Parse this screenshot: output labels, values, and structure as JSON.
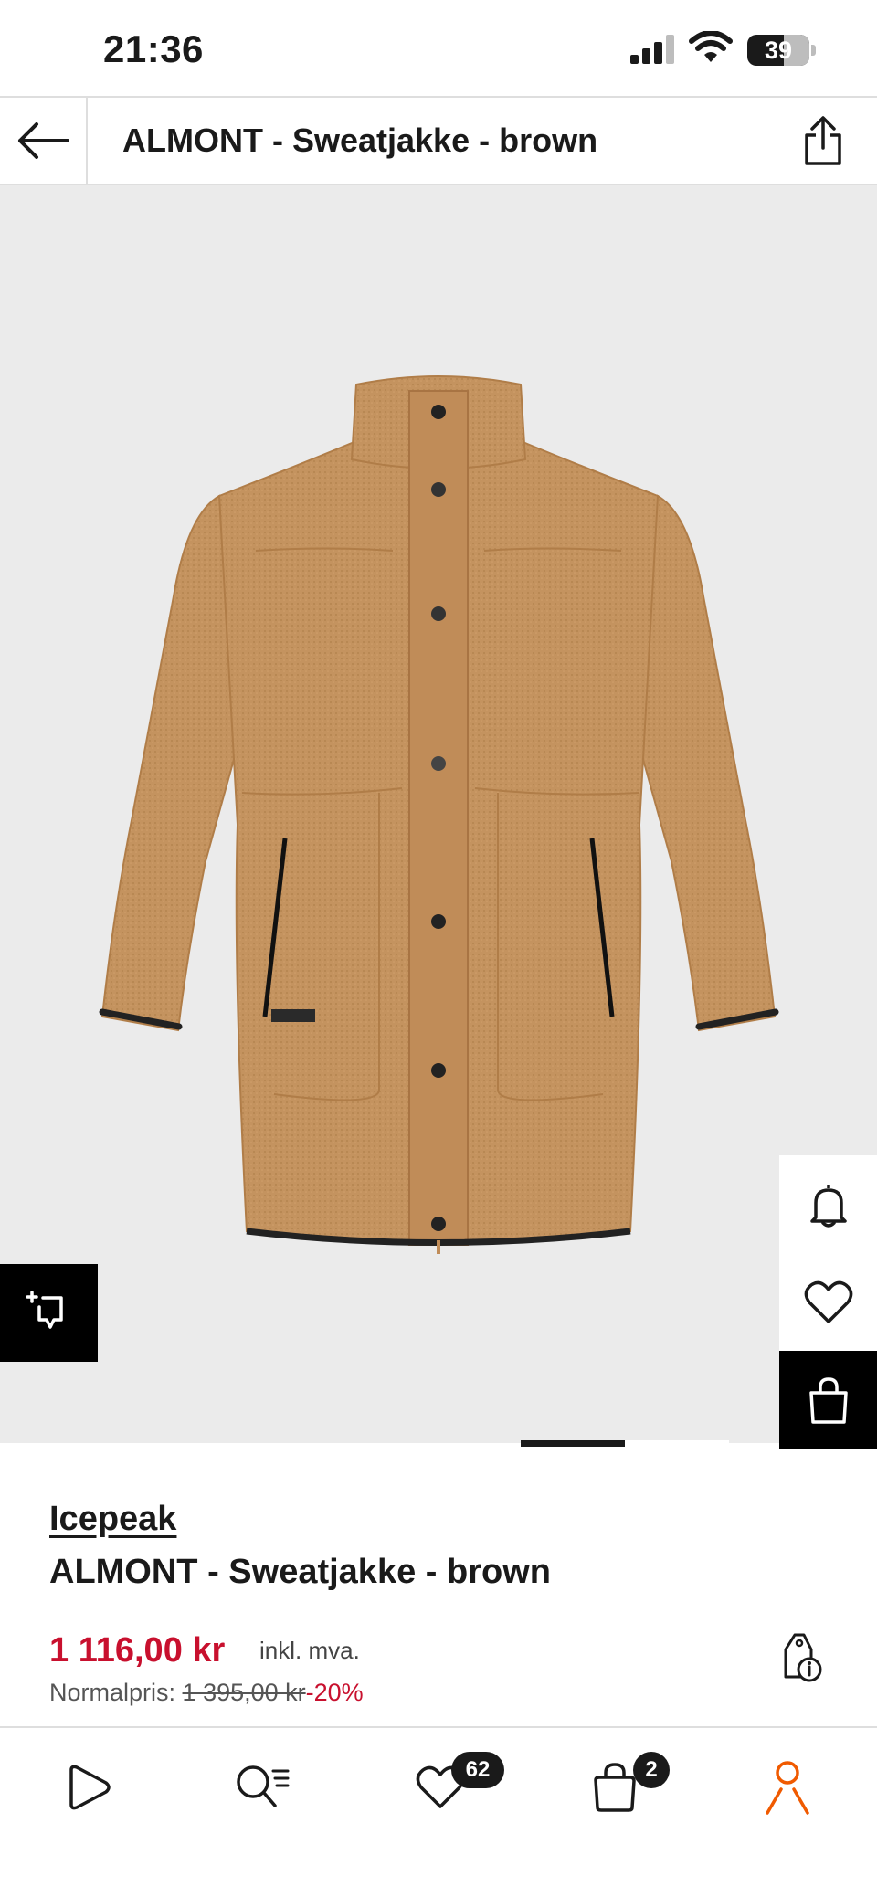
{
  "status_bar": {
    "time": "21:36",
    "battery": "39"
  },
  "header": {
    "title": "ALMONT - Sweatjakke - brown"
  },
  "product": {
    "brand": "Icepeak",
    "name": "ALMONT - Sweatjakke - brown",
    "price": "1 116,00 kr",
    "vat_note": "inkl. mva.",
    "normal_price_label": "Normalpris:",
    "normal_price": "1 395,00 kr",
    "discount": "-20%",
    "image_background": "#ebebeb",
    "jacket_color": "#c4935f"
  },
  "side_actions": [
    "bell-icon",
    "heart-icon",
    "shopping-bag-icon"
  ],
  "bottom_nav": {
    "items": [
      "home-icon",
      "search-icon",
      "wishlist-icon",
      "bag-icon",
      "profile-icon"
    ],
    "wishlist_count": "62",
    "bag_count": "2",
    "accent": "#f05a00"
  }
}
